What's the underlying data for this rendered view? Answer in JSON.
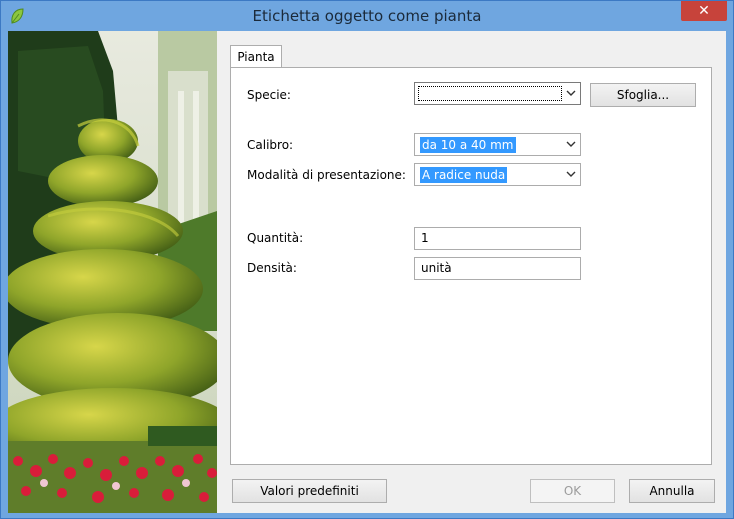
{
  "window": {
    "title": "Etichetta oggetto come pianta",
    "close_label": "✕",
    "accent": "#6fa6e0"
  },
  "tabs": [
    {
      "label": "Pianta",
      "active": true
    }
  ],
  "form": {
    "specie": {
      "label": "Specie:",
      "value": "",
      "browse_label": "Sfoglia..."
    },
    "calibro": {
      "label": "Calibro:",
      "value": "da 10 a 40 mm"
    },
    "modalita": {
      "label": "Modalità di presentazione:",
      "value": "A radice nuda"
    },
    "quantita": {
      "label": "Quantità:",
      "value": "1"
    },
    "densita": {
      "label": "Densità:",
      "value": "unità"
    }
  },
  "footer": {
    "defaults_label": "Valori predefiniti",
    "ok_label": "OK",
    "cancel_label": "Annulla"
  }
}
